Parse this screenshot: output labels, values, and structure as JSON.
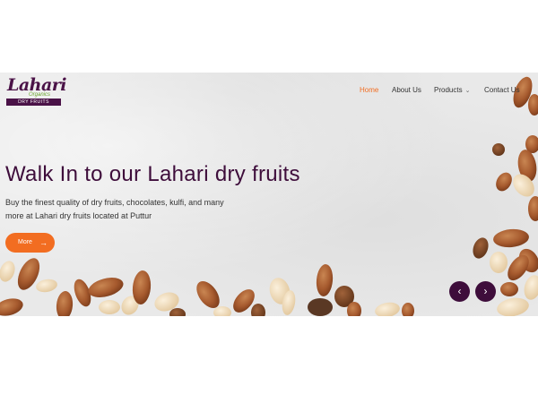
{
  "logo": {
    "name": "Lahari",
    "sub": "Organics",
    "tag": "DRY FRUITS"
  },
  "nav": {
    "items": [
      {
        "label": "Home",
        "active": true
      },
      {
        "label": "About Us",
        "active": false
      },
      {
        "label": "Products",
        "active": false,
        "has_dropdown": true
      },
      {
        "label": "Contact Us",
        "active": false
      }
    ],
    "active_color": "#f26d21"
  },
  "hero": {
    "headline": "Walk In to our Lahari dry fruits",
    "description": "Buy the finest quality of dry fruits, chocolates, kulfi, and many more at Lahari dry fruits located at Puttur",
    "button_label": "More",
    "button_icon": "arrow-right-icon"
  },
  "carousel": {
    "prev_icon": "chevron-left-icon",
    "next_icon": "chevron-right-icon"
  },
  "colors": {
    "brand_purple": "#3e0d3b",
    "accent_orange": "#f26d21",
    "logo_green": "#6aa62e"
  }
}
